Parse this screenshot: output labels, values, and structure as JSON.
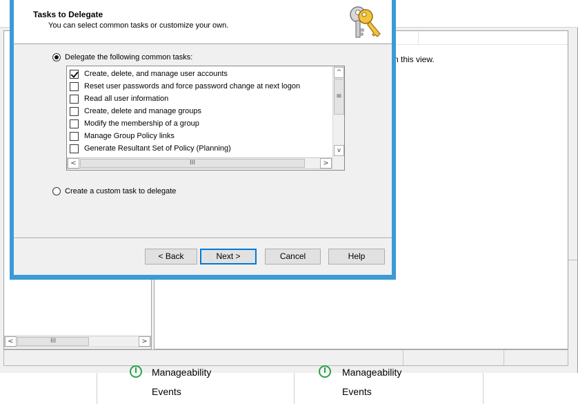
{
  "dialog": {
    "title": "Tasks to Delegate",
    "subtitle": "You can select common tasks or customize your own.",
    "radio_common": {
      "label": "Delegate the following common tasks:",
      "selected": true
    },
    "radio_custom": {
      "label": "Create a custom task to delegate",
      "selected": false
    },
    "tasks": [
      {
        "label": "Create, delete, and manage user accounts",
        "checked": true
      },
      {
        "label": "Reset user passwords and force password change at next logon",
        "checked": false
      },
      {
        "label": "Read all user information",
        "checked": false
      },
      {
        "label": "Create, delete and manage groups",
        "checked": false
      },
      {
        "label": "Modify the membership of a group",
        "checked": false
      },
      {
        "label": "Manage Group Policy links",
        "checked": false
      },
      {
        "label": "Generate Resultant Set of Policy (Planning)",
        "checked": false
      }
    ],
    "buttons": {
      "back": "< Back",
      "next": "Next >",
      "cancel": "Cancel",
      "help": "Help"
    },
    "icon": "keys-icon",
    "accent_color": "#3c9ad7"
  },
  "background": {
    "right_pane_message": "n this view.",
    "tiles": [
      {
        "heading": "Manageability",
        "link": "Events"
      },
      {
        "heading": "Manageability",
        "link": "Events"
      }
    ]
  },
  "scroll_glyphs": {
    "left": "<",
    "right": ">",
    "up": "^",
    "down": "v",
    "grip_h": "III",
    "grip_v": "≡"
  }
}
